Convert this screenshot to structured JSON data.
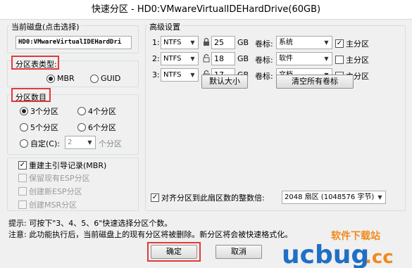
{
  "window": {
    "title": "快速分区 - HD0:VMwareVirtualIDEHardDrive(60GB)"
  },
  "disk": {
    "group_title": "当前磁盘(点击选择)",
    "name": "HD0:VMwareVirtualIDEHardDri"
  },
  "partition_type": {
    "label": "分区表类型:",
    "options": [
      "MBR",
      "GUID"
    ],
    "selected": "MBR"
  },
  "partition_count": {
    "label": "分区数目",
    "options": [
      "3个分区",
      "4个分区",
      "5个分区",
      "6个分区"
    ],
    "custom_label": "自定(C):",
    "custom_value": "2",
    "custom_suffix": "个分区",
    "selected": "3个分区"
  },
  "options": {
    "rebuild_mbr": "重建主引导记录(MBR)",
    "rebuild_mbr_checked": true,
    "keep_esp": "保留现有ESP分区",
    "create_esp": "创建新ESP分区",
    "create_msr": "创建MSR分区"
  },
  "advanced": {
    "title": "高级设置",
    "unit": "GB",
    "volume_label_prefix": "卷标:",
    "primary_label": "主分区",
    "rows": [
      {
        "index": "1:",
        "fs": "NTFS",
        "size": "25",
        "volume": "系统",
        "primary": true
      },
      {
        "index": "2:",
        "fs": "NTFS",
        "size": "18",
        "volume": "软件",
        "primary": false
      },
      {
        "index": "3:",
        "fs": "NTFS",
        "size": "17",
        "volume": "文档",
        "primary": false
      }
    ],
    "default_size_button": "默认大小",
    "clear_labels_button": "清空所有卷标",
    "align_label": "对齐分区到此扇区数的整数倍:",
    "align_checked": true,
    "align_value": "2048 扇区 (1048576 字节)"
  },
  "hints": {
    "tip": "提示: 可按下\"3、4、5、6\"快速选择分区个数。",
    "note": "注意: 此功能执行后，当前磁盘上的现有分区将被删除。新分区将会被快速格式化。"
  },
  "footer": {
    "ok": "确定",
    "cancel": "取消"
  },
  "watermark": {
    "text1": "ucbug",
    "text2": ".cc",
    "text3": "软件下载站"
  },
  "colors": {
    "highlight": "#e03a3a",
    "watermark_blue": "#1f6fc6",
    "watermark_orange": "#f08a1c"
  }
}
